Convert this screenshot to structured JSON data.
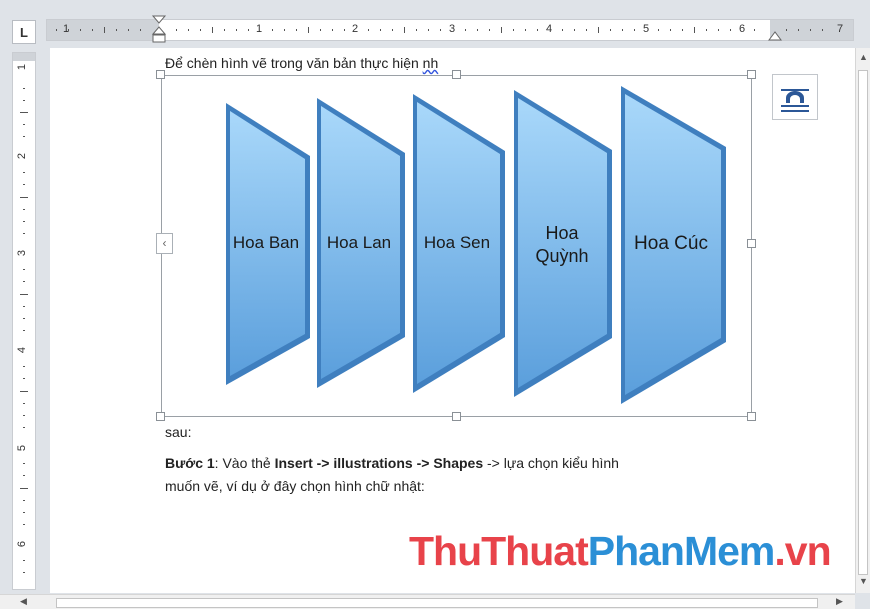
{
  "ruler": {
    "tab_selector": "L",
    "h_numbers": [
      "1",
      "1",
      "2",
      "3",
      "4",
      "5",
      "6",
      "7"
    ],
    "v_numbers": [
      "1",
      "2",
      "3",
      "4",
      "5",
      "6"
    ]
  },
  "document": {
    "line1": "Để chèn hình vẽ trong văn bản thực hiện ",
    "line1_wavy": "nh",
    "line2": "sau:",
    "step_label": "Bước 1",
    "step_text_a": ": Vào thẻ ",
    "step_insert": "Insert -> illustrations -> Shapes",
    "step_text_b": " -> lựa chọn kiểu hình",
    "step_line2": "muốn vẽ, ví dụ ở đây chọn hình chữ nhật:"
  },
  "shapes": [
    {
      "label": "Hoa Ban"
    },
    {
      "label": "Hoa Lan"
    },
    {
      "label": "Hoa Sen"
    },
    {
      "label": "Hoa Quỳnh"
    },
    {
      "label": "Hoa Cúc"
    }
  ],
  "watermark": {
    "part1": "ThuThuat",
    "part2": "PhanMem",
    "part3": ".vn"
  },
  "colors": {
    "shape_fill_top": "#9fd2f7",
    "shape_fill_bottom": "#5b9fdc",
    "shape_edge": "#3f7fbf",
    "watermark_red": "#e8434a",
    "watermark_blue": "#2b8fd6"
  },
  "icons": {
    "layout_options": "layout-options-icon",
    "collapse_panel": "chevron-left-icon",
    "scroll_up": "arrow-up-icon",
    "scroll_down": "arrow-down-icon",
    "scroll_left": "arrow-left-icon",
    "scroll_right": "arrow-right-icon"
  }
}
